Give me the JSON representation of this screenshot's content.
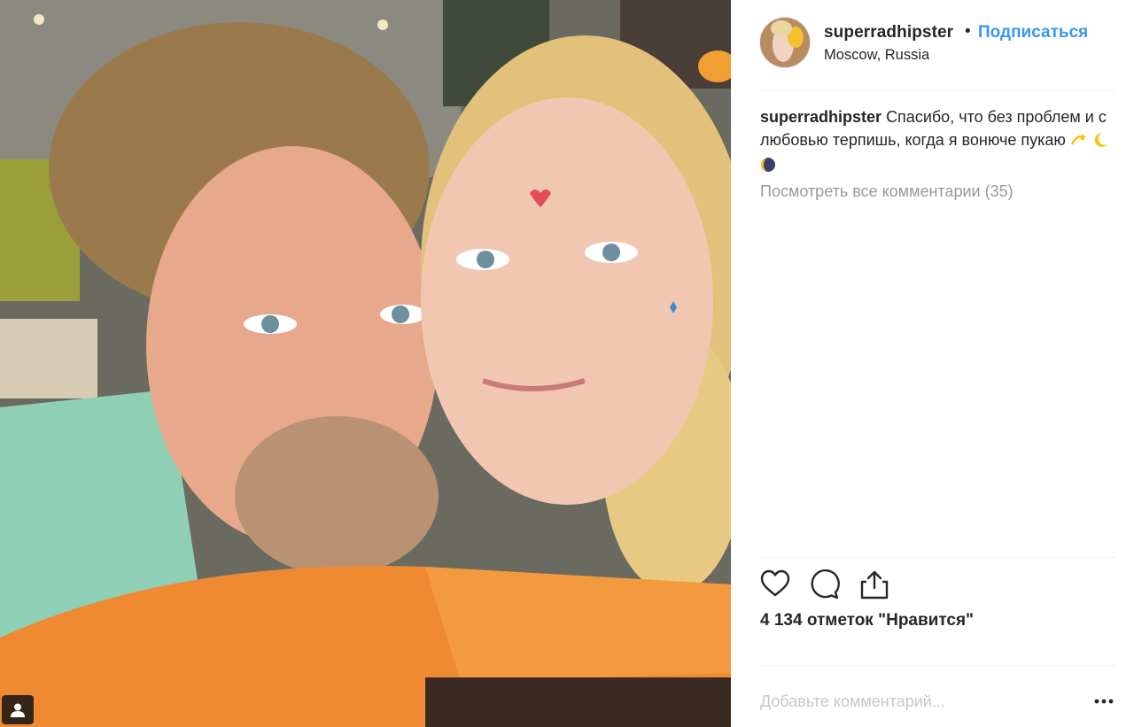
{
  "post": {
    "author": "superradhipster",
    "follow_label": "Подписаться",
    "separator": "•",
    "location": "Moscow, Russia",
    "caption_user": "superradhipster",
    "caption_text": "Спасибо, что без проблем и с любовью терпишь, когда я вонюче пукаю",
    "caption_emojis": [
      "dizzy-icon",
      "crescent-moon-icon",
      "new-moon-icon"
    ],
    "view_all_comments": "Посмотреть все комментарии (35)",
    "likes_text": "4 134 отметок \"Нравится\"",
    "comment_placeholder": "Добавьте комментарий..."
  },
  "actions": [
    "heart-icon",
    "comment-icon",
    "share-icon"
  ],
  "colors": {
    "link_blue": "#3897f0",
    "text": "#262626",
    "muted": "#999999",
    "placeholder": "#c7c7c7",
    "divider": "#efefef"
  }
}
